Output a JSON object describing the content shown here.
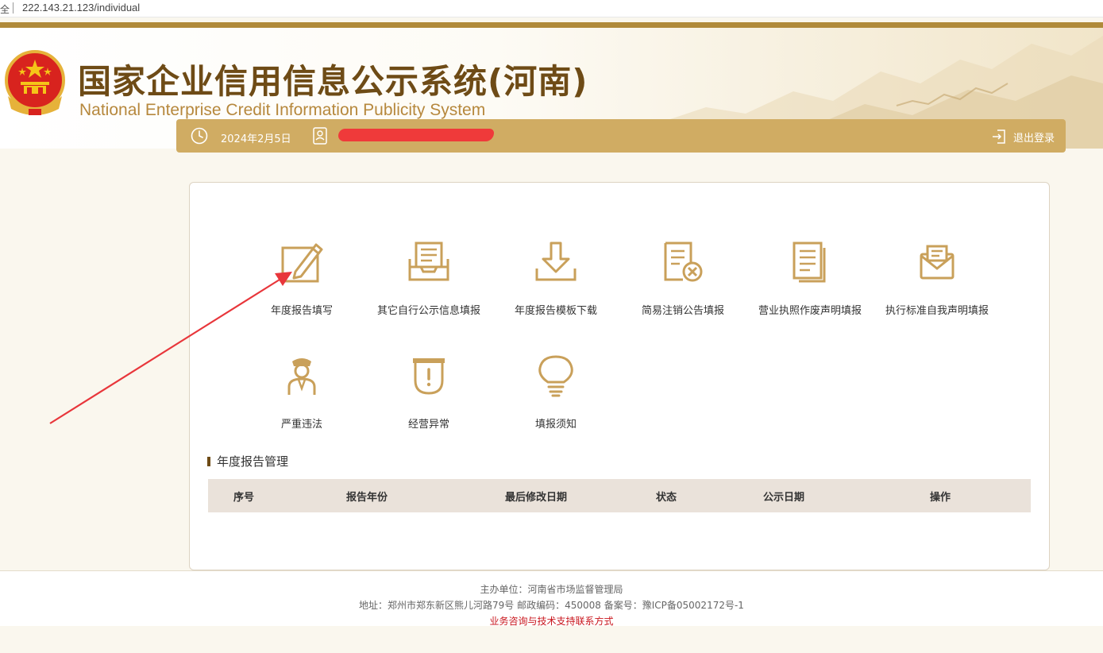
{
  "browser": {
    "lock_text": "全",
    "url": "222.143.21.123/individual"
  },
  "header": {
    "title": "国家企业信用信息公示系统(河南)",
    "subtitle": "National Enterprise Credit Information Publicity System"
  },
  "info_bar": {
    "date": "2024年2月5日",
    "logout_label": "退出登录"
  },
  "tiles": [
    {
      "label": "年度报告填写",
      "icon": "pencil-edit-icon"
    },
    {
      "label": "其它自行公示信息填报",
      "icon": "inbox-icon"
    },
    {
      "label": "年度报告模板下载",
      "icon": "download-icon"
    },
    {
      "label": "简易注销公告填报",
      "icon": "document-cancel-icon"
    },
    {
      "label": "营业执照作废声明填报",
      "icon": "document-lines-icon"
    },
    {
      "label": "执行标准自我声明填报",
      "icon": "envelope-icon"
    },
    {
      "label": "严重违法",
      "icon": "officer-icon"
    },
    {
      "label": "经营异常",
      "icon": "alert-badge-icon"
    },
    {
      "label": "填报须知",
      "icon": "lightbulb-icon"
    }
  ],
  "report_section": {
    "title": "年度报告管理",
    "columns": [
      "序号",
      "报告年份",
      "最后修改日期",
      "状态",
      "公示日期",
      "操作"
    ]
  },
  "footer": {
    "line1": "主办单位：河南省市场监督管理局",
    "line2": "地址：郑州市郑东新区熊儿河路79号 邮政编码：450008 备案号：豫ICP备05002172号-1",
    "line3": "业务咨询与技术支持联系方式"
  },
  "colors": {
    "gold": "#d0ac63",
    "brown": "#6e4b16",
    "icon": "#c9a05a",
    "annotation_arrow": "#e8363b"
  }
}
